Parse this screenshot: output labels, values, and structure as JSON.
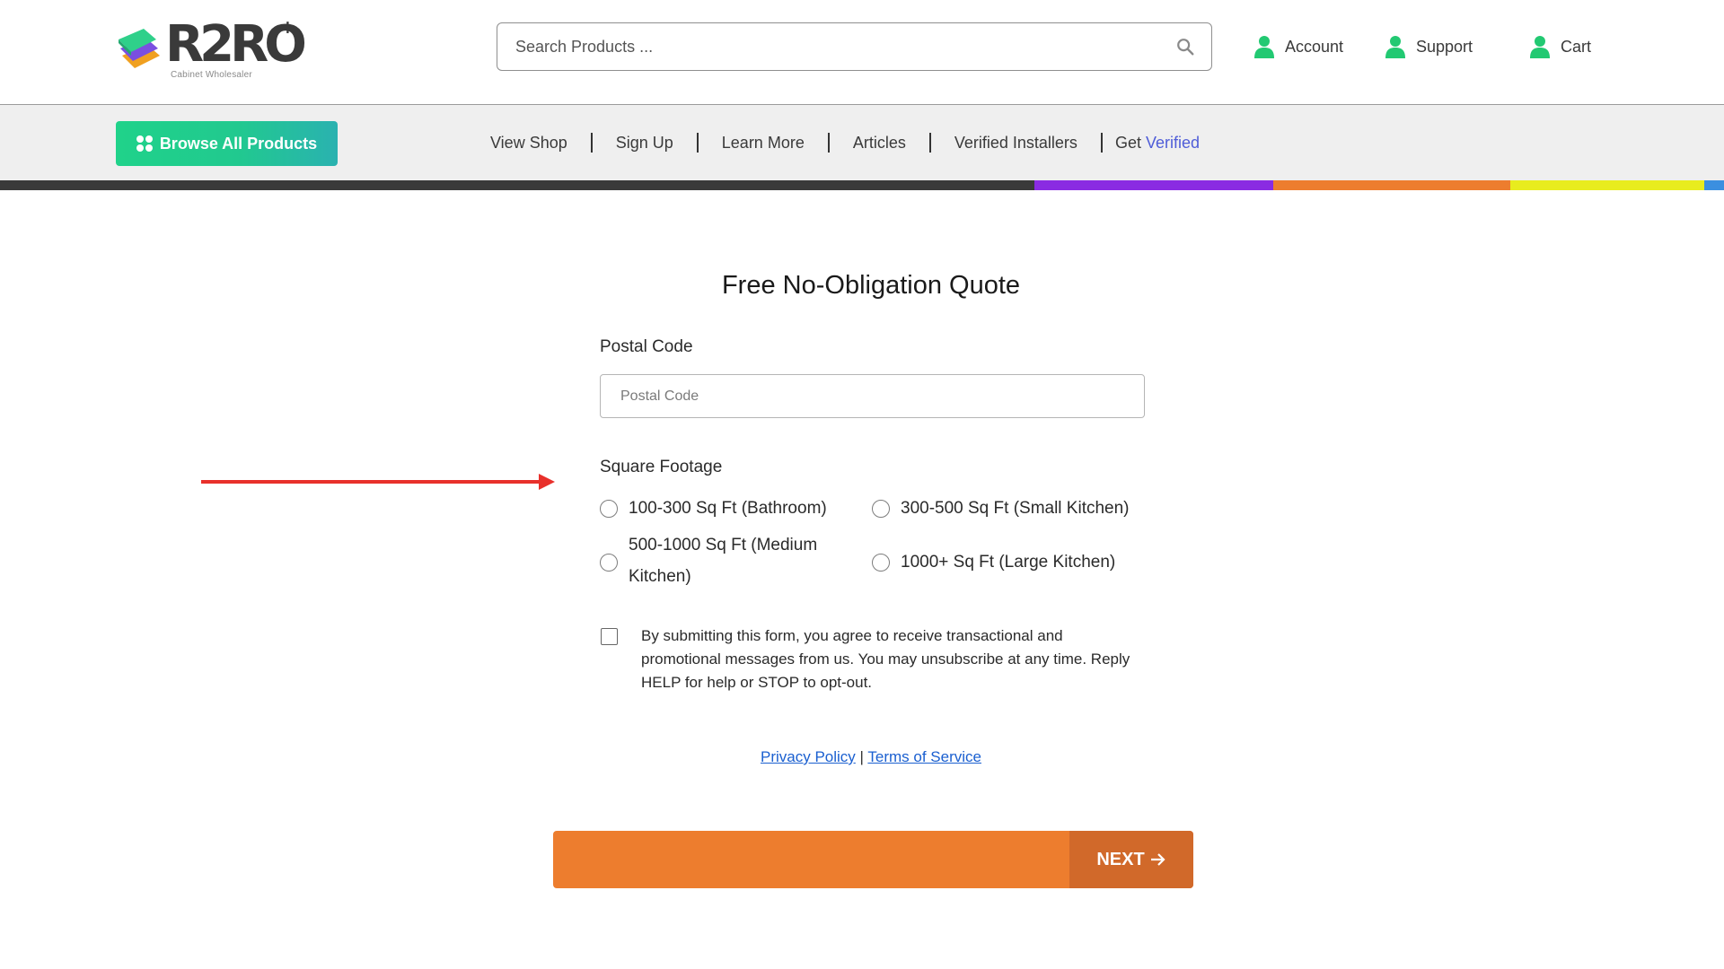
{
  "header": {
    "logo": {
      "brand": "R2RO",
      "plus": "+",
      "tagline": "Cabinet Wholesaler"
    },
    "search": {
      "placeholder": "Search Products ..."
    },
    "links": [
      {
        "label": "Account",
        "icon": "person-icon"
      },
      {
        "label": "Support",
        "icon": "person-icon"
      },
      {
        "label": "Cart",
        "icon": "person-icon"
      }
    ]
  },
  "nav": {
    "browse_label": "Browse All Products",
    "links": [
      "View Shop",
      "Sign Up",
      "Learn More",
      "Articles",
      "Verified Installers"
    ],
    "get_verified": {
      "prefix": "Get ",
      "highlight": "Verified"
    }
  },
  "colors": {
    "accent_green": "#20d28a",
    "accent_orange": "#ed7d2e",
    "next_button": "#d1692a",
    "link_blue": "#1a5fd0",
    "verified_purple": "#4f5dd8",
    "stripe": [
      "#3a3a3a",
      "#8a2be2",
      "#ed7d2e",
      "#e8ec1e",
      "#3b8fe0"
    ]
  },
  "form": {
    "title": "Free No-Obligation Quote",
    "postal": {
      "label": "Postal Code",
      "placeholder": "Postal Code"
    },
    "square_footage": {
      "label": "Square Footage",
      "options": [
        {
          "line1": "100-300 Sq Ft (Bathroom)",
          "line2": ""
        },
        {
          "line1": "300-500 Sq Ft (Small Kitchen)",
          "line2": ""
        },
        {
          "line1": "500-1000 Sq Ft (Medium",
          "line2": "Kitchen)"
        },
        {
          "line1": "1000+ Sq Ft (Large Kitchen)",
          "line2": ""
        }
      ]
    },
    "consent": "By submitting this form, you agree to receive transactional and promotional messages from us. You may unsubscribe at any time. Reply HELP for help or STOP to opt-out.",
    "privacy_label": "Privacy Policy",
    "separator": "|",
    "terms_label": "Terms of Service",
    "next_label": "NEXT"
  }
}
